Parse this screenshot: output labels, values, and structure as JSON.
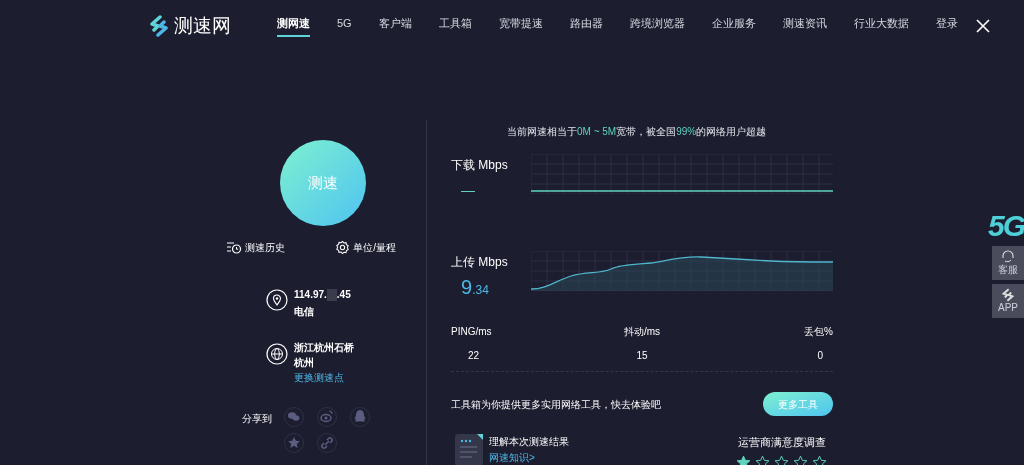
{
  "logo": {
    "text": "测速网"
  },
  "nav": [
    {
      "label": "测网速",
      "selected": true
    },
    {
      "label": "5G",
      "selected": false
    },
    {
      "label": "客户端",
      "selected": false
    },
    {
      "label": "工具箱",
      "selected": false
    },
    {
      "label": "宽带提速",
      "selected": false
    },
    {
      "label": "路由器",
      "selected": false
    },
    {
      "label": "跨境浏览器",
      "selected": false
    },
    {
      "label": "企业服务",
      "selected": false
    },
    {
      "label": "测速资讯",
      "selected": false
    },
    {
      "label": "行业大数据",
      "selected": false
    },
    {
      "label": "登录",
      "selected": false
    }
  ],
  "start_button": "测速",
  "history": "测速历史",
  "units": "单位/量程",
  "ip": {
    "prefix": "114.97.",
    "suffix": ".45",
    "isp": "电信"
  },
  "server": {
    "location": "浙江杭州石桥",
    "city": "杭州",
    "change": "更换测速点"
  },
  "share": {
    "label": "分享到"
  },
  "summary": "当前网速相当于**0M ~ 5M**宽带，被全国**99%**的网络用户超越",
  "download": {
    "label": "下载 Mbps",
    "value": "—"
  },
  "upload": {
    "label": "上传 Mbps",
    "value_int": "9",
    "value_dec": ".34"
  },
  "stats": [
    {
      "label": "PING/ms",
      "value": "22"
    },
    {
      "label": "抖动/ms",
      "value": "15"
    },
    {
      "label": "丢包%",
      "value": "0"
    }
  ],
  "tools": {
    "text": "工具箱为你提供更多实用网络工具，快去体验吧",
    "button": "更多工具"
  },
  "knowledge": {
    "title": "理解本次测速结果",
    "link": "网速知识>"
  },
  "survey": {
    "title": "运营商满意度调查",
    "stars": 1
  },
  "side": {
    "badge": "5G",
    "buttons": [
      {
        "kind": "service",
        "label": "客服"
      },
      {
        "kind": "app",
        "label": "APP"
      }
    ]
  }
}
